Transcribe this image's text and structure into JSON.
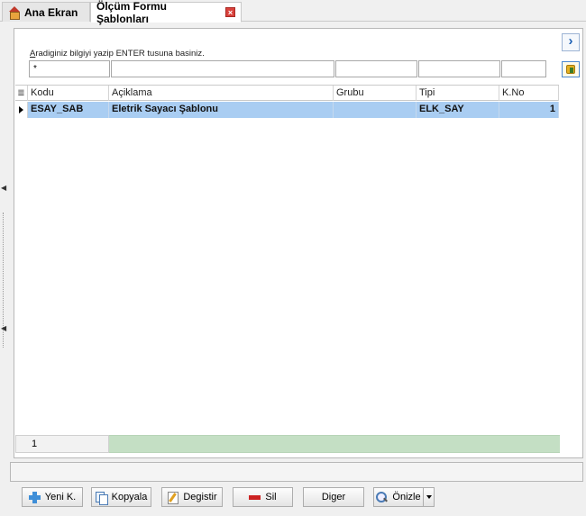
{
  "tabs": {
    "home_label": "Ana Ekran",
    "active_label": "Ölçüm Formu Şablonları"
  },
  "search": {
    "label_underlined": "A",
    "label_rest": "radiginiz bilgiyi yazip ENTER tusuna basiniz.",
    "filter_values": [
      "*",
      "",
      "",
      "",
      ""
    ]
  },
  "grid": {
    "columns": [
      "Kodu",
      "Açiklama",
      "Grubu",
      "Tipi",
      "K.No"
    ],
    "rows": [
      {
        "kodu": "ESAY_SAB",
        "aciklama": "Eletrik Sayacı Şablonu",
        "grubu": "",
        "tipi": "ELK_SAY",
        "kno": "1"
      }
    ],
    "footer_count": "1"
  },
  "buttons": {
    "new": "Yeni K.",
    "copy": "Kopyala",
    "edit": "Degistir",
    "delete": "Sil",
    "other": "Diger",
    "preview": "Önizle"
  },
  "colors": {
    "selected_row": "#a9cdf2",
    "footer_bar": "#c4dfc4",
    "tab_close": "#d9413b"
  }
}
